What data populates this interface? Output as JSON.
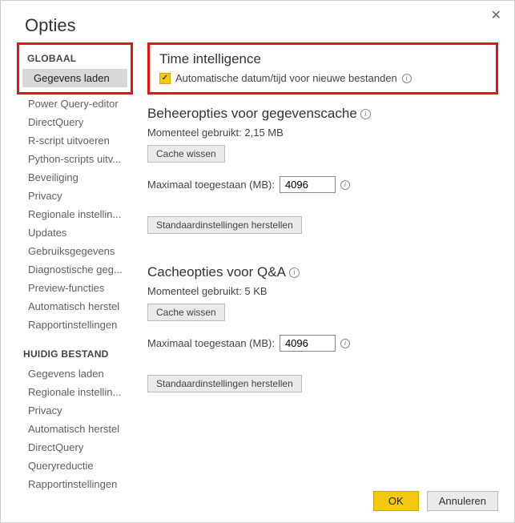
{
  "dialog": {
    "title": "Opties",
    "close": "✕",
    "ok_label": "OK",
    "cancel_label": "Annuleren"
  },
  "sidebar": {
    "global_header": "GLOBAAL",
    "global_items": [
      "Gegevens laden",
      "Power Query-editor",
      "DirectQuery",
      "R-script uitvoeren",
      "Python-scripts uitv...",
      "Beveiliging",
      "Privacy",
      "Regionale instellin...",
      "Updates",
      "Gebruiksgegevens",
      "Diagnostische geg...",
      "Preview-functies",
      "Automatisch herstel",
      "Rapportinstellingen"
    ],
    "current_header": "HUIDIG BESTAND",
    "current_items": [
      "Gegevens laden",
      "Regionale instellin...",
      "Privacy",
      "Automatisch herstel",
      "DirectQuery",
      "Queryreductie",
      "Rapportinstellingen"
    ]
  },
  "main": {
    "time_intelligence": {
      "heading": "Time intelligence",
      "checkbox_label": "Automatische datum/tijd voor nieuwe bestanden"
    },
    "data_cache": {
      "heading": "Beheeropties voor gegevenscache",
      "current_label": "Momenteel gebruikt: 2,15 MB",
      "clear_label": "Cache wissen",
      "max_label": "Maximaal toegestaan (MB):",
      "max_value": "4096",
      "restore_label": "Standaardinstellingen herstellen"
    },
    "qa_cache": {
      "heading": "Cacheopties voor Q&A",
      "current_label": "Momenteel gebruikt: 5 KB",
      "clear_label": "Cache wissen",
      "max_label": "Maximaal toegestaan (MB):",
      "max_value": "4096",
      "restore_label": "Standaardinstellingen herstellen"
    }
  }
}
